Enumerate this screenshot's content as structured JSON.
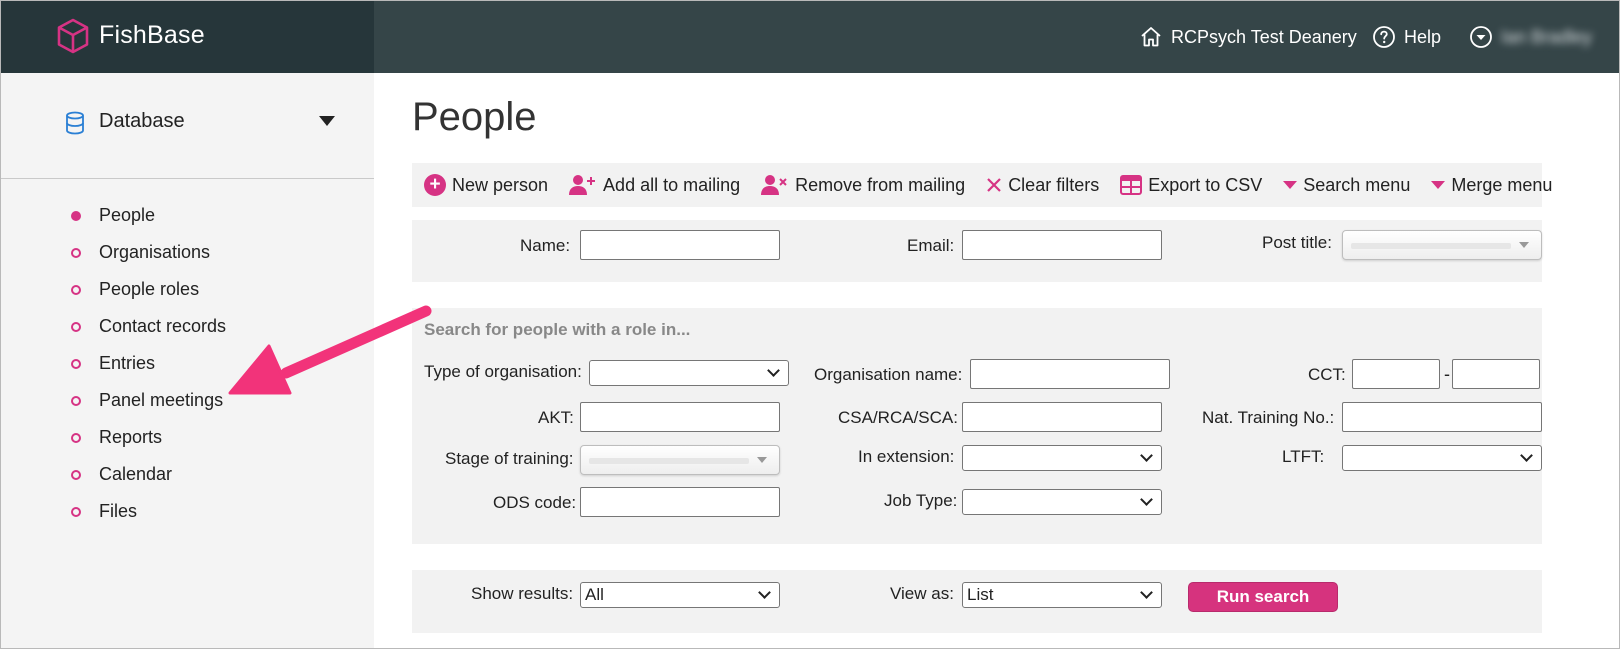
{
  "app": {
    "name": "FishBase",
    "brand_color": "#d63384"
  },
  "header": {
    "deanery_label": "RCPsych Test Deanery",
    "help_label": "Help",
    "user_name": "Ian Bradley"
  },
  "sidebar": {
    "section_label": "Database",
    "items": [
      {
        "label": "People",
        "active": true
      },
      {
        "label": "Organisations"
      },
      {
        "label": "People roles"
      },
      {
        "label": "Contact records"
      },
      {
        "label": "Entries"
      },
      {
        "label": "Panel meetings"
      },
      {
        "label": "Reports"
      },
      {
        "label": "Calendar"
      },
      {
        "label": "Files"
      }
    ]
  },
  "main": {
    "title": "People",
    "toolbar": {
      "new_person": "New person",
      "add_all_to_mailing": "Add all to mailing",
      "remove_from_mailing": "Remove from mailing",
      "clear_filters": "Clear filters",
      "export_to_csv": "Export to CSV",
      "search_menu": "Search menu",
      "merge_menu": "Merge menu"
    },
    "basic_filters": {
      "name_label": "Name:",
      "email_label": "Email:",
      "post_title_label": "Post title:"
    },
    "role_filters": {
      "hint": "Search for people with a role in...",
      "type_of_org_label": "Type of organisation:",
      "org_name_label": "Organisation name:",
      "cct_label": "CCT:",
      "cct_dash": "-",
      "akt_label": "AKT:",
      "csa_label": "CSA/RCA/SCA:",
      "nat_training_label": "Nat. Training No.:",
      "stage_label": "Stage of training:",
      "in_extension_label": "In extension:",
      "ltft_label": "LTFT:",
      "ods_label": "ODS code:",
      "job_type_label": "Job Type:"
    },
    "results": {
      "show_results_label": "Show results:",
      "show_results_value": "All",
      "view_as_label": "View as:",
      "view_as_value": "List",
      "run_search_label": "Run search"
    }
  },
  "annotation": {
    "arrow_color": "#f2337a"
  }
}
